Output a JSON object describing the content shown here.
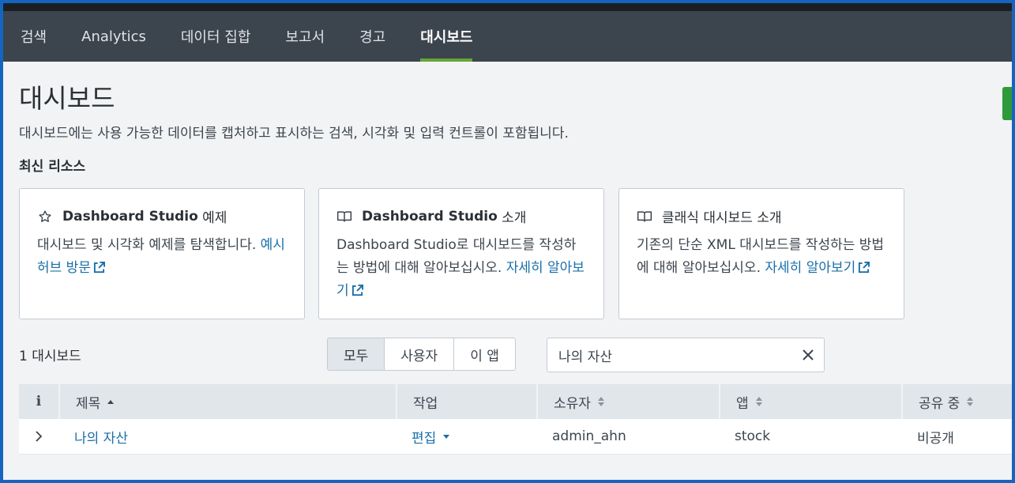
{
  "nav": {
    "items": [
      {
        "label": "검색"
      },
      {
        "label": "Analytics"
      },
      {
        "label": "데이터 집합"
      },
      {
        "label": "보고서"
      },
      {
        "label": "경고"
      },
      {
        "label": "대시보드",
        "active": true
      }
    ]
  },
  "page": {
    "title": "대시보드",
    "description": "대시보드에는 사용 가능한 데이터를 캡처하고 표시하는 검색, 시각화 및 입력 컨트롤이 포함됩니다.",
    "section_title": "최신 리소스"
  },
  "cards": [
    {
      "icon": "star-icon",
      "title_bold": "Dashboard Studio",
      "title_rest": " 예제",
      "body": "대시보드 및 시각화 예제를 탐색합니다. ",
      "link": "예시 허브 방문"
    },
    {
      "icon": "book-icon",
      "title_bold": "Dashboard Studio",
      "title_rest": " 소개",
      "body": "Dashboard Studio로 대시보드를 작성하는 방법에 대해 알아보십시오. ",
      "link": "자세히 알아보기"
    },
    {
      "icon": "book-icon",
      "title_bold": "",
      "title_rest": "클래식 대시보드 소개",
      "body": "기존의 단순 XML 대시보드를 작성하는 방법에 대해 알아보십시오. ",
      "link": "자세히 알아보기"
    }
  ],
  "list": {
    "count_label": "1 대시보드",
    "filters": [
      {
        "label": "모두",
        "active": true
      },
      {
        "label": "사용자"
      },
      {
        "label": "이 앱"
      }
    ],
    "search_value": "나의 자산"
  },
  "table": {
    "headers": [
      "i",
      "제목",
      "작업",
      "소유자",
      "앱",
      "공유 중"
    ],
    "rows": [
      {
        "title": "나의 자산",
        "action": "편집",
        "owner": "admin_ahn",
        "app": "stock",
        "sharing": "비공개"
      }
    ]
  },
  "colors": {
    "accent": "#65a637",
    "link": "#1a6fa9",
    "nav_bg": "#3c444d"
  }
}
